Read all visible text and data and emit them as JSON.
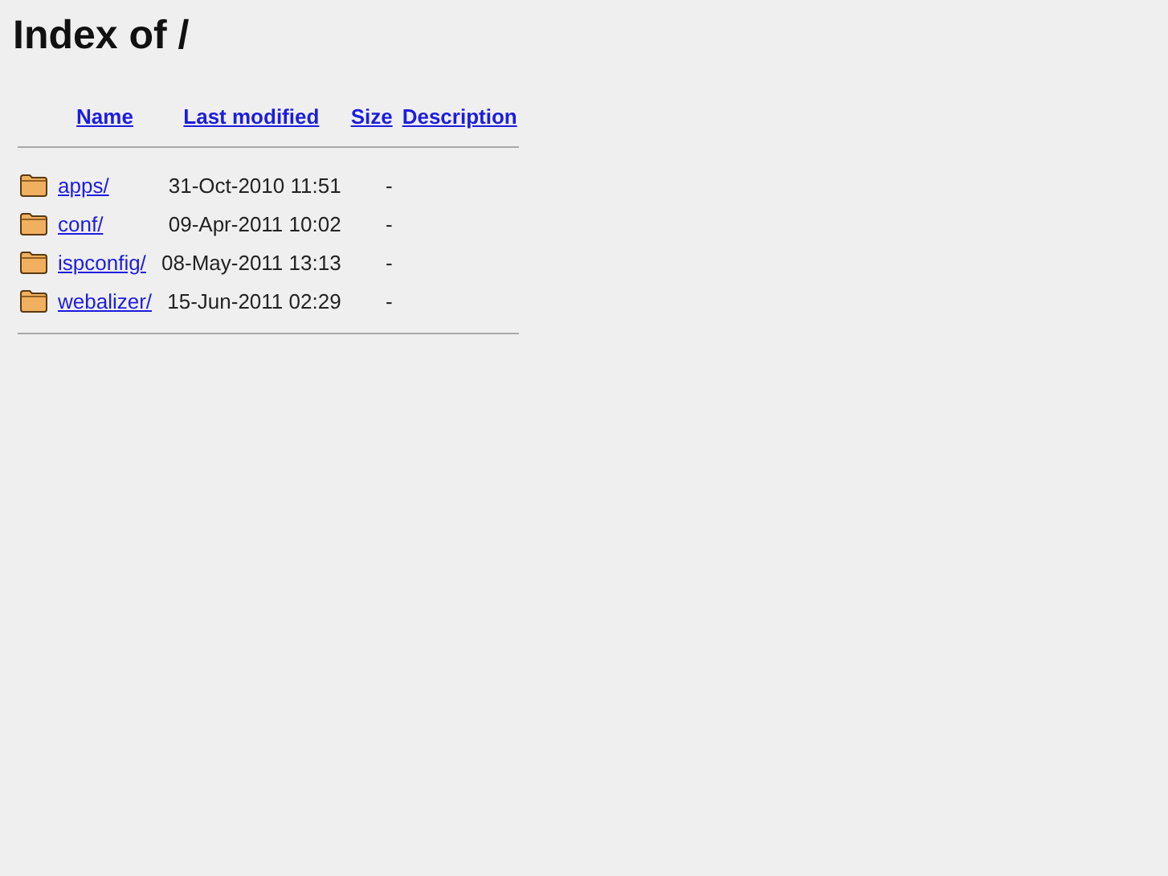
{
  "title": "Index of /",
  "columns": [
    "Name",
    "Last modified",
    "Size",
    "Description"
  ],
  "rows": [
    {
      "name": "apps/",
      "modified": "31-Oct-2010 11:51",
      "size": "-"
    },
    {
      "name": "conf/",
      "modified": "09-Apr-2011 10:02",
      "size": "-"
    },
    {
      "name": "ispconfig/",
      "modified": "08-May-2011 13:13",
      "size": "-"
    },
    {
      "name": "webalizer/",
      "modified": "15-Jun-2011 02:29",
      "size": "-"
    }
  ]
}
